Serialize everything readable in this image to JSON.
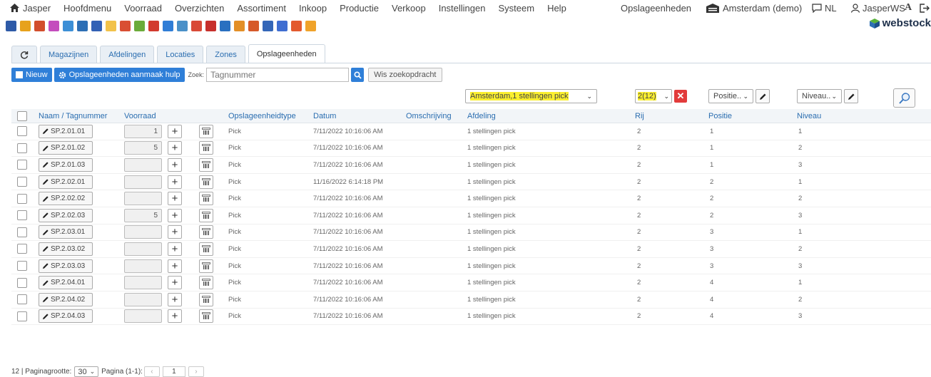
{
  "menu": {
    "items": [
      "Jasper",
      "Hoofdmenu",
      "Voorraad",
      "Overzichten",
      "Assortiment",
      "Inkoop",
      "Productie",
      "Verkoop",
      "Instellingen",
      "Systeem",
      "Help"
    ],
    "opslag": "Opslageenheden",
    "warehouse": "Amsterdam (demo)",
    "language": "NL",
    "user": "JasperWS",
    "font_toggle": "A"
  },
  "logo": "webstock",
  "toolbar_icons": [
    "#2e5aa7",
    "#e7a21c",
    "#d24e2c",
    "#c44dbd",
    "#3c8fd6",
    "#2d6fb5",
    "#3261b5",
    "#f2c24a",
    "#d94f33",
    "#6bab3a",
    "#d23a2e",
    "#2f7dd6",
    "#4a90c8",
    "#d94a37",
    "#c7302c",
    "#2970c0",
    "#e38f27",
    "#d65a2a",
    "#3466b8",
    "#3f6ed1",
    "#e35a2e",
    "#f0a32a"
  ],
  "tabs": [
    "Magazijnen",
    "Afdelingen",
    "Locaties",
    "Zones",
    "Opslageenheden"
  ],
  "actions": {
    "new_label": "Nieuw",
    "help_label": "Opslageenheden aanmaak hulp",
    "search_label": "Zoek:",
    "search_placeholder": "Tagnummer",
    "clear_label": "Wis zoekopdracht"
  },
  "filters": {
    "afdeling": "Amsterdam,1 stellingen pick",
    "rij": "2(12)",
    "positie": "Positie..",
    "niveau": "Niveau.."
  },
  "columns": [
    "Naam / Tagnummer",
    "Voorraad",
    "Opslageenheidtype",
    "Datum",
    "Omschrijving",
    "Afdeling",
    "Rij",
    "Positie",
    "Niveau"
  ],
  "rows": [
    {
      "name": "SP.2.01.01",
      "qty": "1",
      "type": "Pick",
      "date": "7/11/2022 10:16:06 AM",
      "desc": "",
      "afdeling": "1 stellingen pick",
      "rij": "2",
      "positie": "1",
      "niveau": "1"
    },
    {
      "name": "SP.2.01.02",
      "qty": "5",
      "type": "Pick",
      "date": "7/11/2022 10:16:06 AM",
      "desc": "",
      "afdeling": "1 stellingen pick",
      "rij": "2",
      "positie": "1",
      "niveau": "2"
    },
    {
      "name": "SP.2.01.03",
      "qty": "",
      "type": "Pick",
      "date": "7/11/2022 10:16:06 AM",
      "desc": "",
      "afdeling": "1 stellingen pick",
      "rij": "2",
      "positie": "1",
      "niveau": "3"
    },
    {
      "name": "SP.2.02.01",
      "qty": "",
      "type": "Pick",
      "date": "11/16/2022 6:14:18 PM",
      "desc": "",
      "afdeling": "1 stellingen pick",
      "rij": "2",
      "positie": "2",
      "niveau": "1"
    },
    {
      "name": "SP.2.02.02",
      "qty": "",
      "type": "Pick",
      "date": "7/11/2022 10:16:06 AM",
      "desc": "",
      "afdeling": "1 stellingen pick",
      "rij": "2",
      "positie": "2",
      "niveau": "2"
    },
    {
      "name": "SP.2.02.03",
      "qty": "5",
      "type": "Pick",
      "date": "7/11/2022 10:16:06 AM",
      "desc": "",
      "afdeling": "1 stellingen pick",
      "rij": "2",
      "positie": "2",
      "niveau": "3"
    },
    {
      "name": "SP.2.03.01",
      "qty": "",
      "type": "Pick",
      "date": "7/11/2022 10:16:06 AM",
      "desc": "",
      "afdeling": "1 stellingen pick",
      "rij": "2",
      "positie": "3",
      "niveau": "1"
    },
    {
      "name": "SP.2.03.02",
      "qty": "",
      "type": "Pick",
      "date": "7/11/2022 10:16:06 AM",
      "desc": "",
      "afdeling": "1 stellingen pick",
      "rij": "2",
      "positie": "3",
      "niveau": "2"
    },
    {
      "name": "SP.2.03.03",
      "qty": "",
      "type": "Pick",
      "date": "7/11/2022 10:16:06 AM",
      "desc": "",
      "afdeling": "1 stellingen pick",
      "rij": "2",
      "positie": "3",
      "niveau": "3"
    },
    {
      "name": "SP.2.04.01",
      "qty": "",
      "type": "Pick",
      "date": "7/11/2022 10:16:06 AM",
      "desc": "",
      "afdeling": "1 stellingen pick",
      "rij": "2",
      "positie": "4",
      "niveau": "1"
    },
    {
      "name": "SP.2.04.02",
      "qty": "",
      "type": "Pick",
      "date": "7/11/2022 10:16:06 AM",
      "desc": "",
      "afdeling": "1 stellingen pick",
      "rij": "2",
      "positie": "4",
      "niveau": "2"
    },
    {
      "name": "SP.2.04.03",
      "qty": "",
      "type": "Pick",
      "date": "7/11/2022 10:16:06 AM",
      "desc": "",
      "afdeling": "1 stellingen pick",
      "rij": "2",
      "positie": "4",
      "niveau": "3"
    }
  ],
  "footer": {
    "count_label": "12 | Paginagrootte:",
    "page_size": "30",
    "page_label": "Pagina (1-1):",
    "page": "1"
  },
  "colors": {
    "accent": "#2f7fd8",
    "link": "#2a6db0",
    "highlight": "#fbef2f",
    "danger": "#e23b3b"
  }
}
